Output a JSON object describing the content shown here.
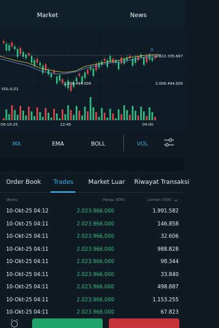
{
  "top_tabs": {
    "market": "Market",
    "news": "News"
  },
  "chart": {
    "price_high": "2.022.335.667",
    "price_mid": "2.006.494.000",
    "price_right": "2.006.494.000",
    "vol_label": "VOL:0,01",
    "time_left": "09-10-25",
    "time_mid": "22:45",
    "time_right": "04:00"
  },
  "indicators": {
    "ma": "MA",
    "ema": "EMA",
    "boll": "BOLL",
    "vol": "VOL"
  },
  "sub_tabs": {
    "order_book": "Order Book",
    "trades": "Trades",
    "market_luar": "Market Luar",
    "riwayat": "Riwayat Transaksi"
  },
  "table": {
    "headers": {
      "waktu": "Waktu",
      "harga": "Harga (IDR)",
      "jumlah": "Jumlah (IDR)"
    },
    "rows": [
      {
        "time": "10-Okt-25 04:12",
        "price": "2.023.966.000",
        "amount": "1.991.582"
      },
      {
        "time": "10-Okt-25 04:11",
        "price": "2.023.966.000",
        "amount": "146.858"
      },
      {
        "time": "10-Okt-25 04:11",
        "price": "2.023.966.000",
        "amount": "32.606"
      },
      {
        "time": "10-Okt-25 04:11",
        "price": "2.023.966.000",
        "amount": "988.828"
      },
      {
        "time": "10-Okt-25 04:11",
        "price": "2.023.966.000",
        "amount": "98.344"
      },
      {
        "time": "10-Okt-25 04:11",
        "price": "2.023.966.000",
        "amount": "33.840"
      },
      {
        "time": "10-Okt-25 04:11",
        "price": "2.023.966.000",
        "amount": "498.887"
      },
      {
        "time": "10-Okt-25 04:11",
        "price": "2.023.966.000",
        "amount": "1.153.255"
      },
      {
        "time": "10-Okt-25 04:11",
        "price": "2.023.966.000",
        "amount": "67.823"
      }
    ]
  },
  "colors": {
    "accent": "#38b3ec",
    "buy": "#1fa36a",
    "sell": "#c8323a",
    "price_green": "#2fbf86"
  }
}
